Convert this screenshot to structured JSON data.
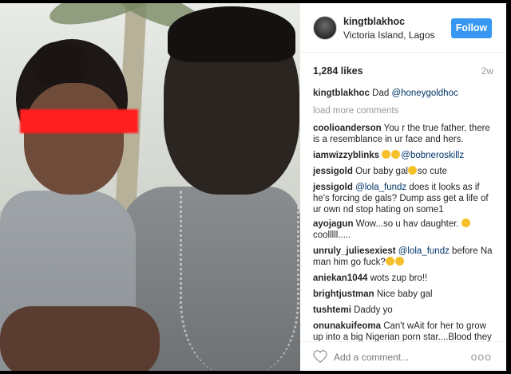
{
  "post": {
    "username": "kingtblakhoc",
    "location": "Victoria Island, Lagos",
    "follow_label": "Follow",
    "likes": "1,284 likes",
    "age": "2w"
  },
  "caption": {
    "user": "kingtblakhoc",
    "text": "Dad ",
    "mention": "@honeygoldhoc"
  },
  "load_more": "load more comments",
  "comments": [
    {
      "user": "coolioanderson",
      "text": "You r the true father, there is a resemblance in ur face and hers."
    },
    {
      "user": "iamwizzyblinks",
      "emojis": 2,
      "mention": "@bobneroskillz"
    },
    {
      "user": "jessigold",
      "pre": "Our baby gal",
      "emoji": 1,
      "post": "so cute"
    },
    {
      "user": "jessigold",
      "mention": "@lola_fundz",
      "text": " does it looks as if he's forcing de gals? Dump ass get a life of ur own nd stop hating on some1"
    },
    {
      "user": "ayojagun",
      "text": "Wow...so u hav daughter. ",
      "post": " coolllll....."
    },
    {
      "user": "unruly_juliesexiest",
      "mention": "@lola_fundz",
      "text": " before Na man him go fuck?"
    },
    {
      "user": "aniekan1044",
      "text": "wots zup bro!!"
    },
    {
      "user": "brightjustman",
      "text": "Nice baby gal"
    },
    {
      "user": "tushtemi",
      "text": "Daddy yo"
    },
    {
      "user": "onunakuifeoma",
      "text": "Can't wAit for her to grow up into a big Nigerian porn star....Blood they"
    }
  ],
  "footer": {
    "placeholder": "Add a comment...",
    "more": "ooo"
  },
  "colors": {
    "follow_button": "#3897f0",
    "mention": "#003569",
    "censor_bar": "#ff1f1f"
  },
  "icons": {
    "heart": "heart-icon",
    "more": "more-options-icon"
  }
}
